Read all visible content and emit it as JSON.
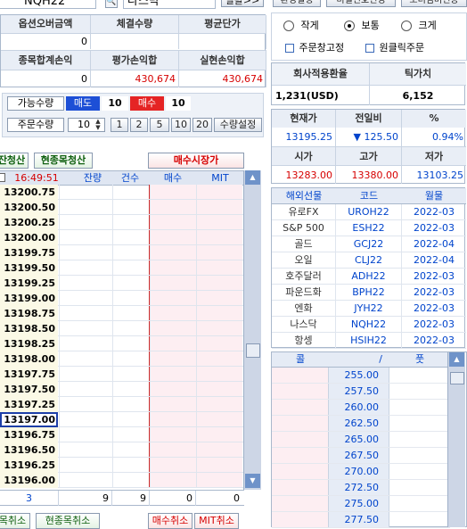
{
  "top": {
    "symbol": "NQH22",
    "product": "나스닥",
    "search_btn": "일괄>>",
    "btn1": "환경설정",
    "btn2": "비밀번호변경",
    "btn3": "오더넘버전송"
  },
  "summary": {
    "h1": "옵션오버금액",
    "h2": "체결수량",
    "h3": "평균단가",
    "v1": "0",
    "v2": "",
    "v3": "",
    "h4": "종목합계손익",
    "h5": "평가손익합",
    "h6": "실현손익합",
    "v4": "0",
    "v5": "430,674",
    "v6": "430,674"
  },
  "qty": {
    "avail_label": "가능수량",
    "sell_label": "매도",
    "sell_val": "10",
    "buy_label": "매수",
    "buy_val": "10",
    "order_label": "주문수량",
    "order_val": "10",
    "q1": "1",
    "q2": "2",
    "q3": "5",
    "q4": "10",
    "q5": "20",
    "set_btn": "수량설정"
  },
  "actions": {
    "clear": "잔청산",
    "clear_item": "현종목청산",
    "market_buy": "매수시장가"
  },
  "grid": {
    "time": "16:49:51",
    "cols": [
      "잔량",
      "건수",
      "매수",
      "MIT"
    ],
    "prices": [
      "13200.75",
      "13200.50",
      "13200.25",
      "13200.00",
      "13199.75",
      "13199.50",
      "13199.25",
      "13199.00",
      "13198.75",
      "13198.50",
      "13198.25",
      "13198.00",
      "13197.75",
      "13197.50",
      "13197.25",
      "13197.00",
      "13196.75",
      "13196.50",
      "13196.25",
      "13196.00"
    ],
    "selected_index": 15,
    "footer": [
      "3",
      "9",
      "9",
      "0",
      "0"
    ]
  },
  "bottom": {
    "b1": "목취소",
    "b2": "현종목취소",
    "b3": "매수취소",
    "b4": "MIT취소"
  },
  "radio": {
    "opt1": "작게",
    "opt2": "보통",
    "opt3": "크게",
    "selected": "보통",
    "chk1": "주문창고정",
    "chk2": "원클릭주문"
  },
  "fx": {
    "h1": "회사적용환율",
    "h2": "틱가치",
    "v1": "1,231(USD)",
    "v2": "6,152"
  },
  "quote": {
    "h1": "현재가",
    "h2": "전일비",
    "h3": "%",
    "v1": "13195.25",
    "arrow": "▼",
    "v2": "125.50",
    "v3": "0.94%",
    "h4": "시가",
    "h5": "고가",
    "h6": "저가",
    "v4": "13283.00",
    "v5": "13380.00",
    "v6": "13103.25"
  },
  "futures": {
    "cols": [
      "해외선물",
      "코드",
      "월물"
    ],
    "rows": [
      [
        "유로FX",
        "UROH22",
        "2022-03"
      ],
      [
        "S&P 500",
        "ESH22",
        "2022-03"
      ],
      [
        "골드",
        "GCJ22",
        "2022-04"
      ],
      [
        "오일",
        "CLJ22",
        "2022-04"
      ],
      [
        "호주달러",
        "ADH22",
        "2022-03"
      ],
      [
        "파운드화",
        "BPH22",
        "2022-03"
      ],
      [
        "엔화",
        "JYH22",
        "2022-03"
      ],
      [
        "나스닥",
        "NQH22",
        "2022-03"
      ],
      [
        "항셍",
        "HSIH22",
        "2022-03"
      ]
    ]
  },
  "options": {
    "cols": [
      "콜",
      "/",
      "풋"
    ],
    "strikes": [
      "255.00",
      "257.50",
      "260.00",
      "262.50",
      "265.00",
      "267.50",
      "270.00",
      "272.50",
      "275.00",
      "277.50"
    ]
  }
}
